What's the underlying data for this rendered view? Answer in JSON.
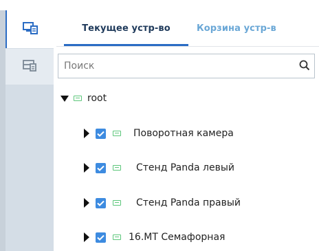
{
  "sidebar": {
    "buttons": [
      {
        "icon": "device-list-icon",
        "active": true
      },
      {
        "icon": "device-trash-icon",
        "active": false
      }
    ]
  },
  "tabs": [
    {
      "label": "Текущее устр-во",
      "active": true
    },
    {
      "label": "Корзина устр-в",
      "active": false
    }
  ],
  "search": {
    "placeholder": "Поиск",
    "value": "",
    "icon": "search-icon"
  },
  "tree": {
    "root": {
      "label": "root",
      "expanded": true
    },
    "children": [
      {
        "label": "Поворотная камера",
        "checked": true
      },
      {
        "label": "Стенд Panda левый",
        "checked": true
      },
      {
        "label": "Стенд Panda правый",
        "checked": true
      },
      {
        "label": "16.МТ Семафорная",
        "checked": true
      }
    ]
  },
  "colors": {
    "accent": "#2a6cc4",
    "checkbox": "#3d8be0",
    "device_icon": "#5cc67a",
    "rail": "#d4dde6",
    "inactive_tab": "#6aa7d6"
  }
}
